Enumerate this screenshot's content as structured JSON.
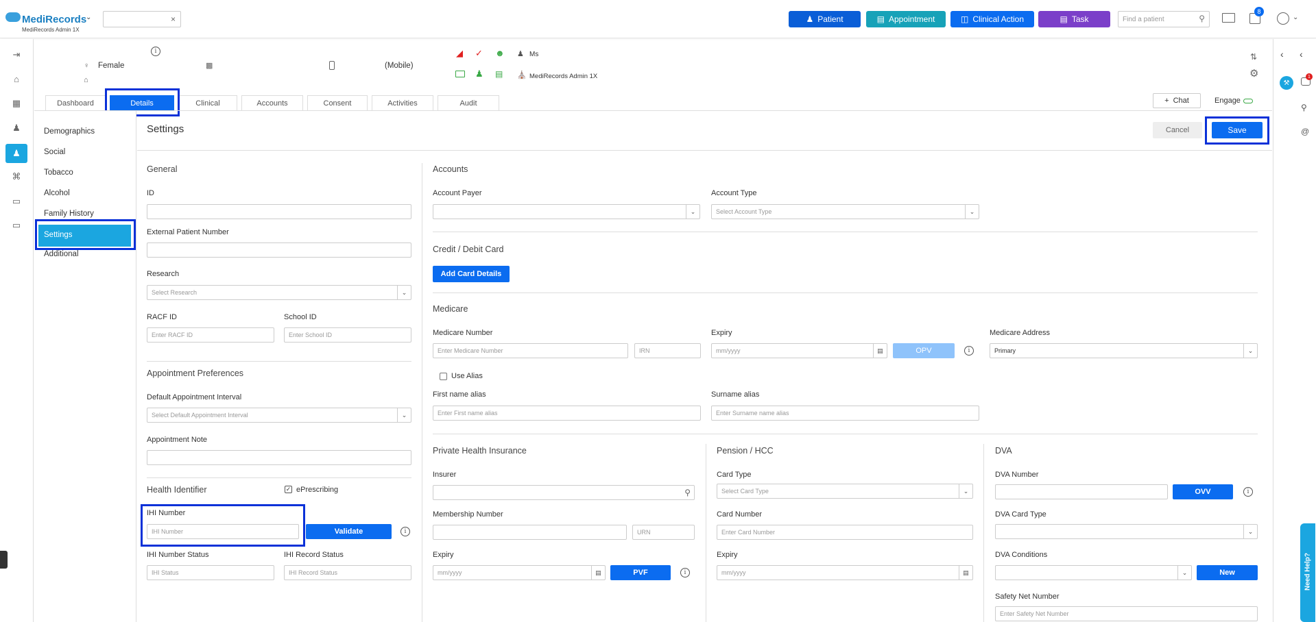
{
  "brand": {
    "name": "MediRecords",
    "sub": "MediRecords Admin 1X"
  },
  "topbar": {
    "patient_btn": "Patient",
    "appointment_btn": "Appointment",
    "clinical_action_btn": "Clinical Action",
    "task_btn": "Task",
    "find_placeholder": "Find a patient",
    "tasks_badge": "8"
  },
  "patient_header": {
    "gender": "Female",
    "mobile": "(Mobile)",
    "title": "Ms",
    "practice": "MediRecords Admin 1X"
  },
  "tabs": [
    "Dashboard",
    "Details",
    "Clinical",
    "Accounts",
    "Consent",
    "Activities",
    "Audit"
  ],
  "chat_label": "Chat",
  "engage_label": "Engage",
  "side_menu": [
    "Demographics",
    "Social",
    "Tobacco",
    "Alcohol",
    "Family History",
    "Settings",
    "Additional"
  ],
  "page_title": "Settings",
  "cancel_btn": "Cancel",
  "save_btn": "Save",
  "general": {
    "heading": "General",
    "id_label": "ID",
    "external_label": "External Patient Number",
    "research_label": "Research",
    "research_placeholder": "Select Research",
    "racf_label": "RACF ID",
    "racf_placeholder": "Enter RACF ID",
    "school_label": "School ID",
    "school_placeholder": "Enter School ID"
  },
  "appointment_prefs": {
    "heading": "Appointment Preferences",
    "interval_label": "Default Appointment Interval",
    "interval_placeholder": "Select Default Appointment Interval",
    "note_label": "Appointment Note"
  },
  "health_identifier": {
    "heading": "Health Identifier",
    "eprescribing": "ePrescribing",
    "ihi_label": "IHI Number",
    "ihi_placeholder": "IHI Number",
    "validate_btn": "Validate",
    "ihi_status_label": "IHI Number Status",
    "ihi_status_placeholder": "IHI Status",
    "ihi_record_label": "IHI Record Status",
    "ihi_record_placeholder": "IHI Record Status"
  },
  "accounts": {
    "heading": "Accounts",
    "payer_label": "Account Payer",
    "type_label": "Account Type",
    "type_placeholder": "Select Account Type"
  },
  "card": {
    "heading": "Credit / Debit Card",
    "add_btn": "Add Card Details"
  },
  "medicare": {
    "heading": "Medicare",
    "number_label": "Medicare Number",
    "number_placeholder": "Enter Medicare Number",
    "irn_placeholder": "IRN",
    "expiry_label": "Expiry",
    "expiry_placeholder": "mm/yyyy",
    "opv_btn": "OPV",
    "address_label": "Medicare Address",
    "address_value": "Primary",
    "use_alias": "Use Alias",
    "first_alias_label": "First name alias",
    "first_alias_placeholder": "Enter First name alias",
    "surname_alias_label": "Surname alias",
    "surname_alias_placeholder": "Enter Surname name alias"
  },
  "phi": {
    "heading": "Private Health Insurance",
    "insurer_label": "Insurer",
    "membership_label": "Membership Number",
    "urn_placeholder": "URN",
    "expiry_label": "Expiry",
    "expiry_placeholder": "mm/yyyy",
    "pvf_btn": "PVF"
  },
  "pension": {
    "heading": "Pension / HCC",
    "card_type_label": "Card Type",
    "card_type_placeholder": "Select Card Type",
    "card_number_label": "Card Number",
    "card_number_placeholder": "Enter Card Number",
    "expiry_label": "Expiry",
    "expiry_placeholder": "mm/yyyy"
  },
  "dva": {
    "heading": "DVA",
    "number_label": "DVA Number",
    "ovv_btn": "OVV",
    "card_type_label": "DVA Card Type",
    "conditions_label": "DVA Conditions",
    "new_btn": "New",
    "safety_label": "Safety Net Number",
    "safety_placeholder": "Enter Safety Net Number"
  },
  "need_help": "Need Help?",
  "notif_badge": "1",
  "colors": {
    "primary": "#0b6cf0",
    "appointment": "#17a2b8",
    "task": "#7b3fc9",
    "highlight": "#0a31d8",
    "active_menu": "#1ba6e0"
  }
}
